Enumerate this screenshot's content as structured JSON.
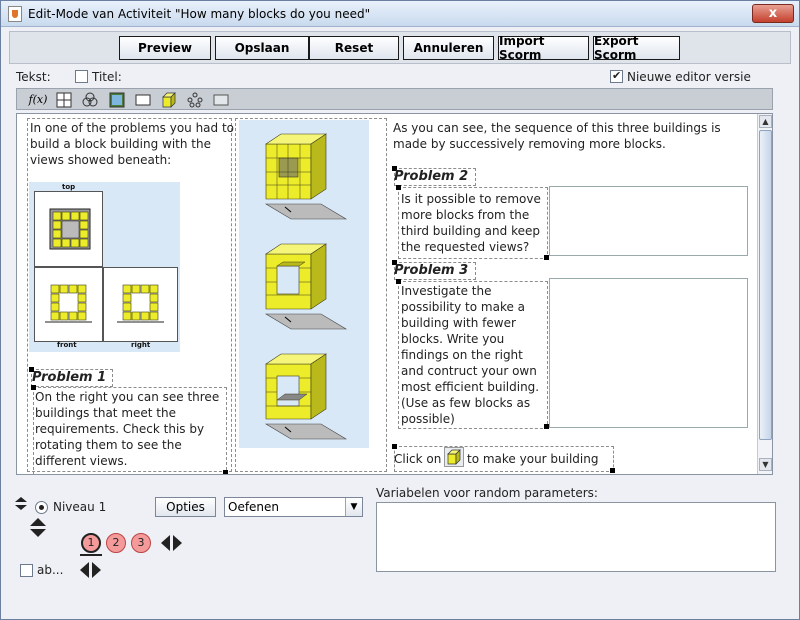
{
  "window": {
    "title": "Edit-Mode van Activiteit \"How many blocks do you need\"",
    "close_glyph": "x"
  },
  "buttons": {
    "preview": "Preview",
    "save": "Opslaan",
    "reset": "Reset",
    "cancel": "Annuleren",
    "import": "Import Scorm",
    "export": "Export Scorm"
  },
  "options_row": {
    "text_label": "Tekst:",
    "title_label": "Titel:",
    "title_checked": false,
    "editor_label": "Nieuwe editor versie",
    "editor_checked": true
  },
  "toolbar": {
    "formula_label": "f(x)",
    "icons": [
      "formula-icon",
      "grid-icon",
      "applet-icon",
      "image-icon",
      "textbox-icon",
      "cube-icon",
      "graph-icon",
      "rectangle-icon"
    ]
  },
  "content": {
    "intro": "In one of the problems you had to build a block building with the views showed beneath:",
    "views": {
      "top": "top",
      "front": "front",
      "right": "right"
    },
    "problem1": {
      "title": "Problem 1",
      "text": "On the right you can see three buildings that meet the requirements.  Check this by rotating them to see the different views."
    },
    "sequence": "As you can see, the sequence of this three buildings is made by successively removing more blocks.",
    "problem2": {
      "title": "Problem 2",
      "text": "Is it possible to remove more blocks from the third building and keep the requested views?"
    },
    "problem3": {
      "title": "Problem 3",
      "text": "Investigate the possibility to make a building with fewer blocks. Write you findings on the right and contruct your own most efficient building.\n(Use as few blocks as possible)"
    },
    "click_before": "Click on",
    "click_after": "to make your building"
  },
  "bottom": {
    "level_label": "Niveau 1",
    "options_button": "Opties",
    "mode_value": "Oefenen",
    "levels": [
      "1",
      "2",
      "3"
    ],
    "active_level": "1",
    "ab_label": "ab...",
    "variables_label": "Variabelen voor random parameters:"
  },
  "colors": {
    "cube_yellow": "#ecec2a",
    "panel_blue": "#d9e8f7",
    "level_pink": "#f49a9a"
  }
}
